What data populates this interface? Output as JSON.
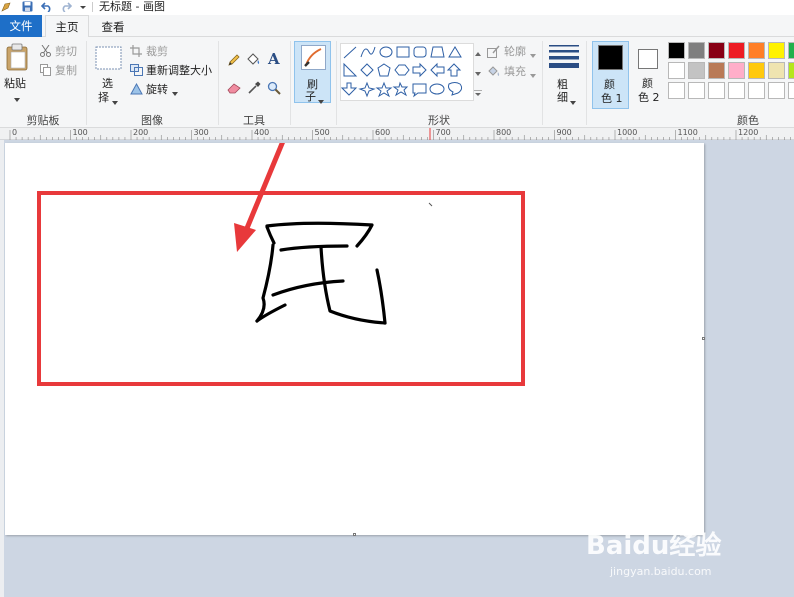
{
  "window": {
    "title": "无标题 - 画图"
  },
  "tabs": {
    "file": "文件",
    "home": "主页",
    "view": "查看"
  },
  "clipboard": {
    "paste": "粘贴",
    "cut": "剪切",
    "copy": "复制",
    "group": "剪贴板"
  },
  "image": {
    "select_line1": "选",
    "select_line2": "择",
    "crop": "裁剪",
    "resize": "重新调整大小",
    "rotate": "旋转",
    "group": "图像"
  },
  "tools": {
    "group": "工具"
  },
  "brush": {
    "line1": "刷",
    "line2": "子"
  },
  "shapes": {
    "outline": "轮廓",
    "fill": "填充",
    "group": "形状"
  },
  "size": {
    "line1": "粗",
    "line2": "细"
  },
  "colors": {
    "color1_line1": "颜",
    "color1_line2": "色 1",
    "color2_line1": "颜",
    "color2_line2": "色 2",
    "group": "颜色",
    "color1_value": "#000000",
    "color2_value": "#ffffff",
    "palette_row1": [
      "#000000",
      "#7f7f7f",
      "#880015",
      "#ed1c24",
      "#ff7f27",
      "#fff200",
      "#22b14c"
    ],
    "palette_row2": [
      "#ffffff",
      "#c3c3c3",
      "#b97a57",
      "#ffaec9",
      "#ffc90e",
      "#efe4b0",
      "#b5e61d"
    ],
    "palette_row3": [
      "#ffffff",
      "#ffffff",
      "#ffffff",
      "#ffffff",
      "#ffffff",
      "#ffffff",
      "#ffffff"
    ]
  },
  "ruler": {
    "labels": [
      "0",
      "100",
      "200",
      "300",
      "400",
      "500",
      "600",
      "700",
      "800",
      "900",
      "1000",
      "1100",
      "1200"
    ]
  },
  "canvas": {
    "drawn_character": "民",
    "highlight_color": "#e8393b",
    "arrow_color": "#e8393b"
  },
  "watermark": {
    "brand": "Baidu经验",
    "url": "jingyan.baidu.com"
  }
}
